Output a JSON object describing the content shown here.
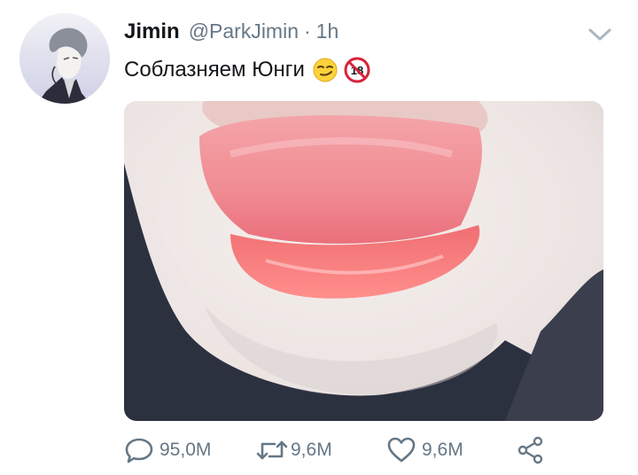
{
  "tweet": {
    "author_name": "Jimin",
    "author_handle": "@ParkJimin",
    "separator": "·",
    "time": "1h",
    "text": "Соблазняем Юнги",
    "emojis": [
      "smirking-face",
      "no-one-under-eighteen"
    ]
  },
  "actions": {
    "reply_count": "95,0M",
    "retweet_count": "9,6M",
    "like_count": "9,6M"
  },
  "colors": {
    "text_primary": "#14171a",
    "text_secondary": "#657786",
    "background": "#ffffff"
  }
}
